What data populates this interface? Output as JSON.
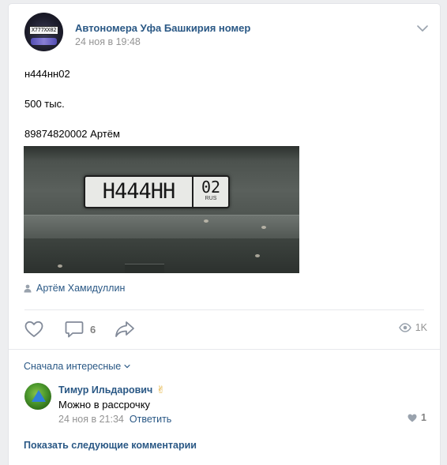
{
  "post": {
    "author": "Автономера Уфа Башкирия номер",
    "date": "24 ноя в 19:48",
    "avatar_plate_text": "Х777ХХ02",
    "text_lines": [
      "н444нн02",
      "500 тыс.",
      "89874820002 Артём"
    ],
    "photo": {
      "plate_main": "Н444НН",
      "plate_region": "02",
      "plate_country": "RUS"
    },
    "signer": "Артём Хамидуллин"
  },
  "actions": {
    "like_icon": "heart-icon",
    "comment_icon": "comment-icon",
    "comment_count": "6",
    "share_icon": "share-icon",
    "views_icon": "eye-icon",
    "views": "1K"
  },
  "comments": {
    "sort_label": "Сначала интересные",
    "items": [
      {
        "author": "Тимур Ильдарович",
        "author_emoji": "✌",
        "text": "Можно в рассрочку",
        "date": "24 ноя в 21:34",
        "reply_label": "Ответить",
        "likes": "1"
      }
    ],
    "show_more_label": "Показать следующие комментарии"
  },
  "colors": {
    "link": "#2a5885",
    "muted": "#939393",
    "icon": "#99a2ad",
    "background": "#edeef0"
  }
}
